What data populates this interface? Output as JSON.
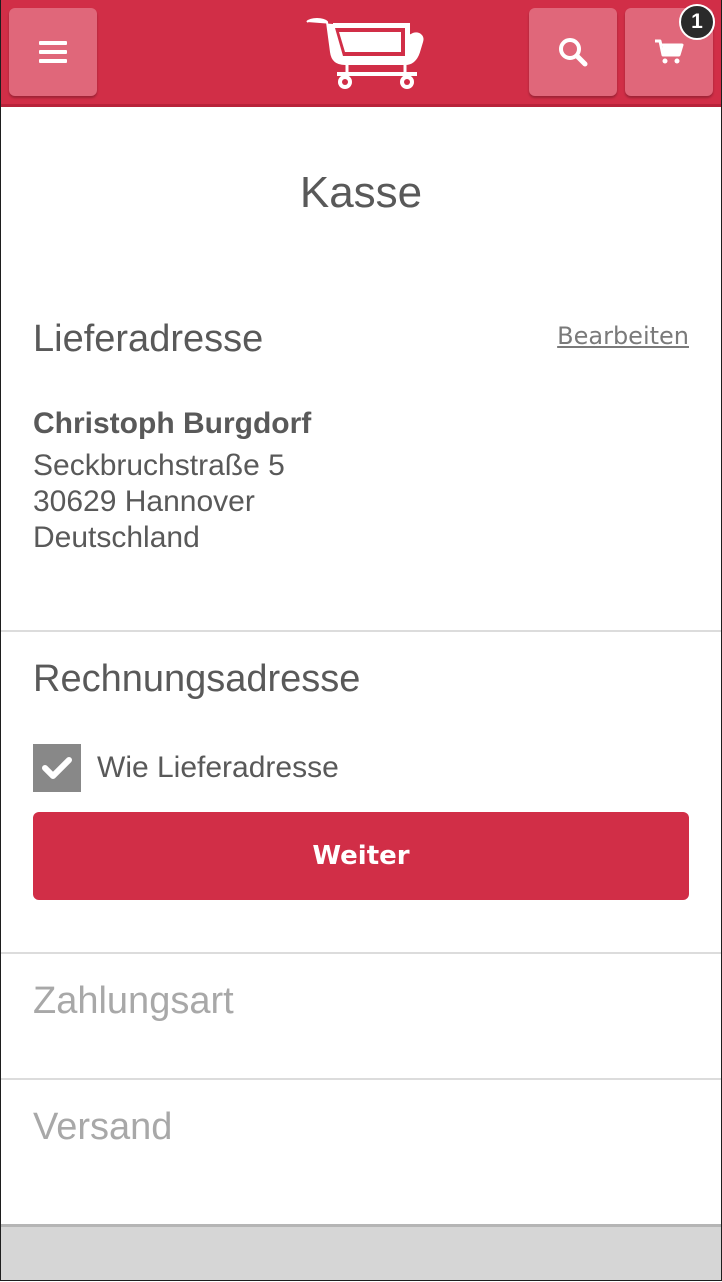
{
  "header": {
    "menu_icon": "hamburger-icon",
    "search_icon": "search-icon",
    "cart_icon": "cart-icon",
    "cart_count": "1",
    "logo": "shopping-cart-logo",
    "accent_color": "#d12e47"
  },
  "page": {
    "title": "Kasse"
  },
  "shipping": {
    "heading": "Lieferadresse",
    "edit_label": "Bearbeiten",
    "name": "Christoph Burgdorf",
    "street": "Seckbruchstraße 5",
    "city": "30629 Hannover",
    "country": "Deutschland"
  },
  "billing": {
    "heading": "Rechnungsadresse",
    "same_as_shipping_label": "Wie Lieferadresse",
    "same_as_shipping_checked": true,
    "continue_label": "Weiter"
  },
  "steps": {
    "payment": "Zahlungsart",
    "delivery": "Versand"
  }
}
